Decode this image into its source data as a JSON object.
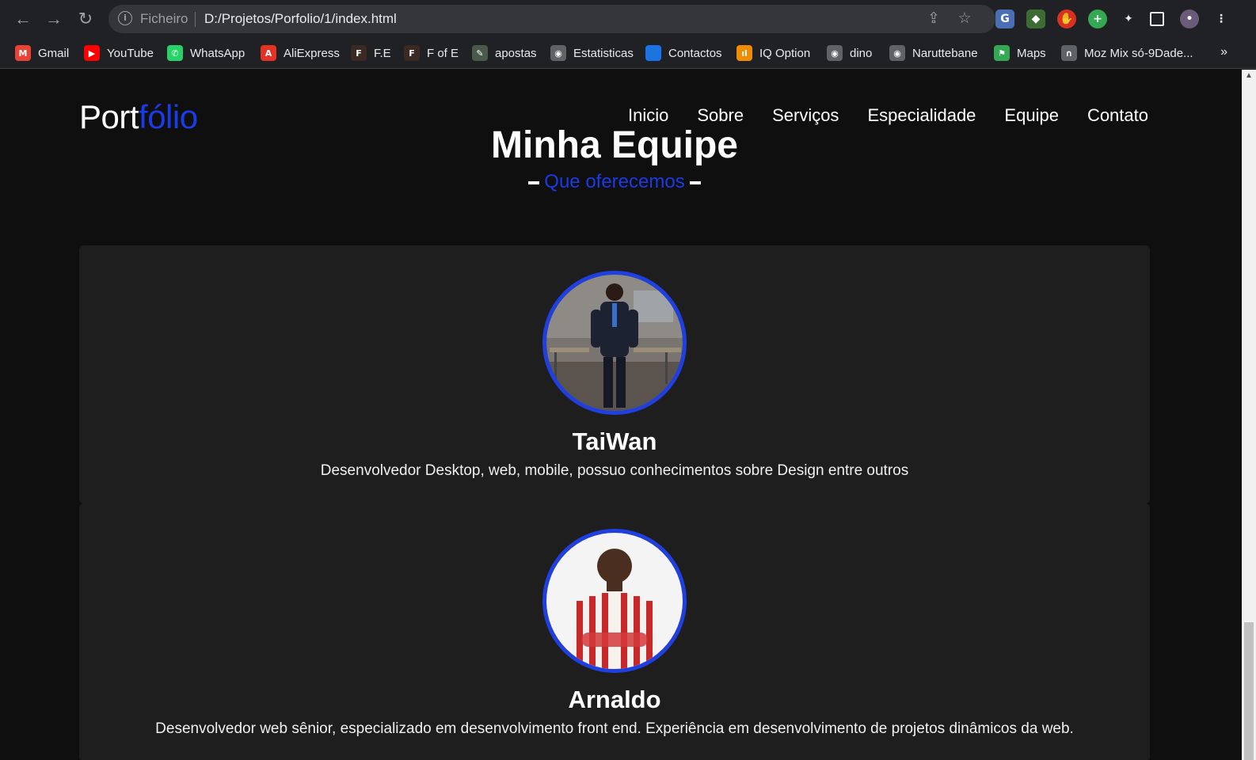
{
  "browser": {
    "scheme_label": "Ficheiro",
    "url": "D:/Projetos/Porfolio/1/index.html",
    "bookmarks": [
      {
        "label": "Gmail",
        "color": "#ea4335",
        "glyph": "M"
      },
      {
        "label": "YouTube",
        "color": "#ff0000",
        "glyph": "▶"
      },
      {
        "label": "WhatsApp",
        "color": "#25d366",
        "glyph": "✆"
      },
      {
        "label": "AliExpress",
        "color": "#e43225",
        "glyph": "A"
      },
      {
        "label": "F.E",
        "color": "#3a2a22",
        "glyph": "F"
      },
      {
        "label": "F of E",
        "color": "#3a2a22",
        "glyph": "F"
      },
      {
        "label": "apostas",
        "color": "#4a5a4a",
        "glyph": "✎"
      },
      {
        "label": "Estatisticas",
        "color": "#5f6368",
        "glyph": "◉"
      },
      {
        "label": "Contactos",
        "color": "#1a73e8",
        "glyph": "👤"
      },
      {
        "label": "IQ Option",
        "color": "#f08c00",
        "glyph": "ıl"
      },
      {
        "label": "dino",
        "color": "#5f6368",
        "glyph": "◉"
      },
      {
        "label": "Naruttebane",
        "color": "#5f6368",
        "glyph": "◉"
      },
      {
        "label": "Maps",
        "color": "#34a853",
        "glyph": "⚑"
      },
      {
        "label": "Moz Mix só-9Dade...",
        "color": "#5f6368",
        "glyph": "∩"
      }
    ],
    "more_bookmarks": "»"
  },
  "site": {
    "logo_main": "Port",
    "logo_accent": "fólio",
    "accent_color": "#1a3be8",
    "menu": [
      "Inicio",
      "Sobre",
      "Serviços",
      "Especialidade",
      "Equipe",
      "Contato"
    ]
  },
  "team": {
    "title": "Minha Equipe",
    "subtitle": "Que oferecemos",
    "members": [
      {
        "name": "TaiWan",
        "description": "Desenvolvedor Desktop, web, mobile, possuo conhecimentos sobre Design entre outros"
      },
      {
        "name": "Arnaldo",
        "description": "Desenvolvedor web sênior, especializado em desenvolvimento front end. Experiência em desenvolvimento de projetos dinâmicos da web."
      }
    ]
  }
}
